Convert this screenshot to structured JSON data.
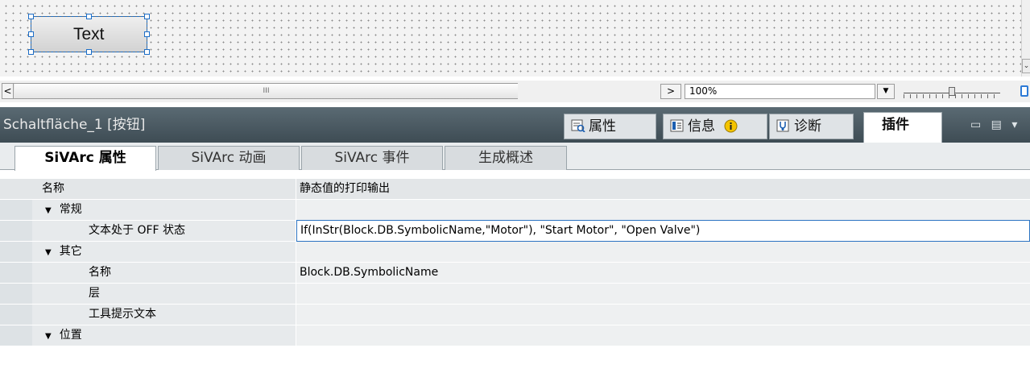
{
  "canvas": {
    "widget_text": "Text"
  },
  "scrollbar": {
    "left_arrow": "<",
    "thumb_grip": "III"
  },
  "zoom": {
    "next_arrow": ">",
    "value": "100%",
    "dropdown_arrow": "▼",
    "slider_level_percent": 50
  },
  "inspector": {
    "title": "Schaltfläche_1 [按钮]",
    "tabs": [
      {
        "label": "属性",
        "icon": "properties-icon"
      },
      {
        "label": "信息",
        "icon": "info-icon"
      },
      {
        "label": "诊断",
        "icon": "diagnostics-icon"
      },
      {
        "label": "插件",
        "icon": ""
      }
    ],
    "window_controls": "▭ ▤ ▾"
  },
  "subtabs": [
    "SiVArc 属性",
    "SiVArc 动画",
    "SiVArc 事件",
    "生成概述"
  ],
  "grid": {
    "col_name": "名称",
    "col_value": "静态值的打印输出",
    "rows": [
      {
        "type": "group",
        "name": "常规",
        "value": ""
      },
      {
        "type": "item",
        "name": "文本处于 OFF 状态",
        "value": "If(InStr(Block.DB.SymbolicName,\"Motor\"), \"Start Motor\", \"Open Valve\")"
      },
      {
        "type": "group",
        "name": "其它",
        "value": ""
      },
      {
        "type": "item",
        "name": "名称",
        "value": "Block.DB.SymbolicName"
      },
      {
        "type": "item",
        "name": "层",
        "value": ""
      },
      {
        "type": "item",
        "name": "工具提示文本",
        "value": ""
      },
      {
        "type": "group",
        "name": "位置",
        "value": ""
      }
    ]
  },
  "colors": {
    "titlebar": "#4a5961",
    "selection": "#1c6ec8"
  }
}
